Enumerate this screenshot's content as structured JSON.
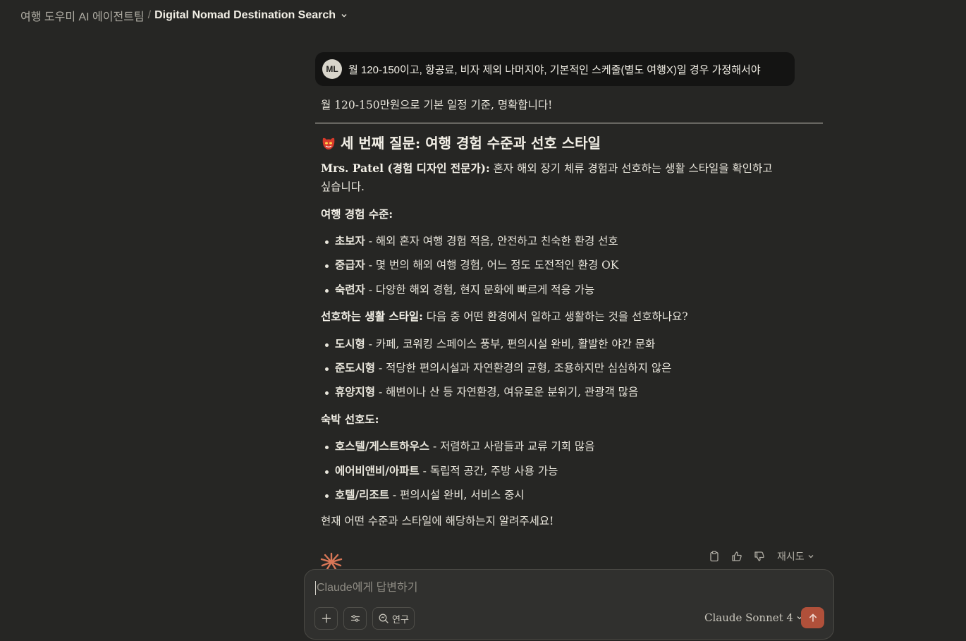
{
  "breadcrumb": {
    "team": "여행 도우미 AI 에이전트팀",
    "separator": "/",
    "title": "Digital Nomad Destination Search"
  },
  "user_message": {
    "avatar_initials": "ML",
    "text": "월 120-150이고, 항공료, 비자 제외 나머지야, 기본적인 스케줄(별도 여행X)일 경우 가정해서야"
  },
  "assistant": {
    "intro": "월 120-150만원으로 기본 일정 기준, 명확합니다!",
    "heading_icon": "red-mask-emoji",
    "heading": "세 번째 질문: 여행 경험 수준과 선호 스타일",
    "expert_name": "Mrs. Patel (경험 디자인 전문가):",
    "expert_text_line1": " 혼자 해외 장기 체류 경험과 선호하는 생활 스타일을 확인하고",
    "expert_text_line2": "싶습니다.",
    "experience_title": "여행 경험 수준:",
    "experience_items": [
      {
        "label": "초보자",
        "desc": " - 해외 혼자 여행 경험 적음, 안전하고 친숙한 환경 선호"
      },
      {
        "label": "중급자",
        "desc": " - 몇 번의 해외 여행 경험, 어느 정도 도전적인 환경 OK"
      },
      {
        "label": "숙련자",
        "desc": " - 다양한 해외 경험, 현지 문화에 빠르게 적응 가능"
      }
    ],
    "lifestyle_title": "선호하는 생활 스타일:",
    "lifestyle_question": " 다음 중 어떤 환경에서 일하고 생활하는 것을 선호하나요?",
    "lifestyle_items": [
      {
        "label": "도시형",
        "desc": " - 카페, 코워킹 스페이스 풍부, 편의시설 완비, 활발한 야간 문화"
      },
      {
        "label": "준도시형",
        "desc": " - 적당한 편의시설과 자연환경의 균형, 조용하지만 심심하지 않은"
      },
      {
        "label": "휴양지형",
        "desc": " - 해변이나 산 등 자연환경, 여유로운 분위기, 관광객 많음"
      }
    ],
    "lodging_title": "숙박 선호도:",
    "lodging_items": [
      {
        "label": "호스텔/게스트하우스",
        "desc": " - 저렴하고 사람들과 교류 기회 많음"
      },
      {
        "label": "에어비앤비/아파트",
        "desc": " - 독립적 공간, 주방 사용 가능"
      },
      {
        "label": "호텔/리조트",
        "desc": " - 편의시설 완비, 서비스 중시"
      }
    ],
    "closing": "현재 어떤 수준과 스타일에 해당하는지 알려주세요!"
  },
  "actions": {
    "copy_icon": "clipboard-icon",
    "like_icon": "thumbs-up-icon",
    "dislike_icon": "thumbs-down-icon",
    "retry_label": "재시도"
  },
  "composer": {
    "placeholder": "Claude에게 답변하기",
    "research_label": "연구",
    "model_label": "Claude Sonnet 4"
  },
  "colors": {
    "background": "#262624",
    "bubble": "#141413",
    "accent": "#b0503a",
    "spark": "#d97757"
  }
}
